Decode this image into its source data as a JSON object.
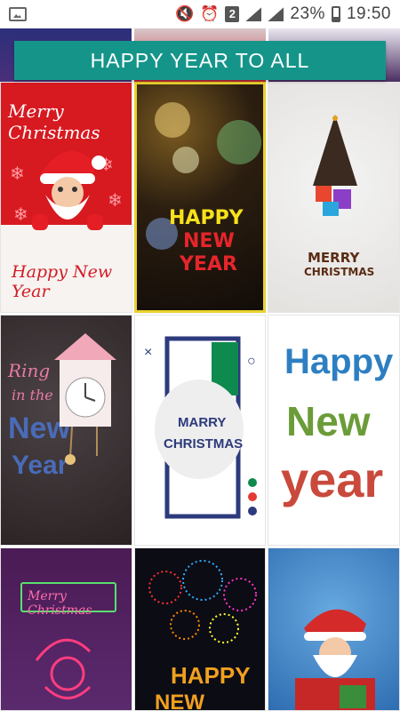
{
  "status_bar": {
    "sim_number": "2",
    "battery": "23%",
    "time": "19:50"
  },
  "banner": {
    "title": "HAPPY YEAR TO ALL"
  },
  "cards": [
    {
      "id": "merry-christmas-santa",
      "lines": [
        "Merry Christmas",
        "Happy New Year"
      ]
    },
    {
      "id": "happy-new-year-bokeh",
      "lines": [
        "HAPPY",
        "NEW",
        "YEAR"
      ]
    },
    {
      "id": "merry-christmas-tree",
      "lines": [
        "MERRY",
        "CHRISTMAS"
      ]
    },
    {
      "id": "ring-in-new-year",
      "lines": [
        "Ring",
        "in the",
        "New",
        "Year"
      ]
    },
    {
      "id": "marry-christmas",
      "lines": [
        "MARRY",
        "CHRISTMAS"
      ]
    },
    {
      "id": "happy-new-year-letters",
      "lines": [
        "Happy",
        "New",
        "year"
      ]
    },
    {
      "id": "merry-christmas-neon",
      "lines": [
        "Merry Christmas"
      ]
    },
    {
      "id": "happy-new-year-fireworks",
      "lines": [
        "HAPPY",
        "NEW YEAR"
      ]
    },
    {
      "id": "santa-snow",
      "lines": []
    }
  ],
  "colors": {
    "banner_bg": "#15958a",
    "santa_red": "#d71920",
    "highlight_border": "#e9d12e"
  }
}
